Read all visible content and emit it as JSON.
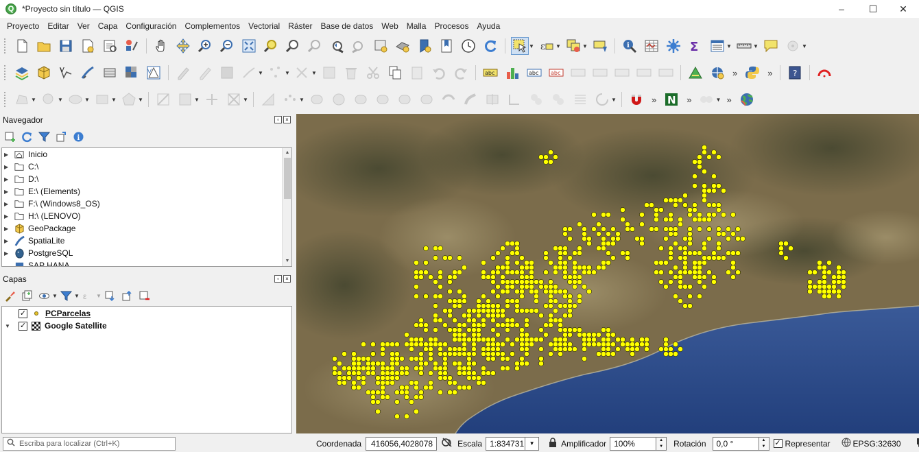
{
  "window": {
    "title": "*Proyecto sin título — QGIS",
    "controls": [
      "–",
      "☐",
      "✕"
    ]
  },
  "menu": [
    "Proyecto",
    "Editar",
    "Ver",
    "Capa",
    "Configuración",
    "Complementos",
    "Vectorial",
    "Ráster",
    "Base de datos",
    "Web",
    "Malla",
    "Procesos",
    "Ayuda"
  ],
  "navigator": {
    "title": "Navegador",
    "items": [
      {
        "label": "Inicio",
        "icon": "home-folder-icon"
      },
      {
        "label": "C:\\",
        "icon": "folder-icon"
      },
      {
        "label": "D:\\",
        "icon": "folder-icon"
      },
      {
        "label": "E:\\ (Elements)",
        "icon": "folder-icon"
      },
      {
        "label": "F:\\ (Windows8_OS)",
        "icon": "folder-icon"
      },
      {
        "label": "H:\\ (LENOVO)",
        "icon": "folder-icon"
      },
      {
        "label": "GeoPackage",
        "icon": "geopackage-icon"
      },
      {
        "label": "SpatiaLite",
        "icon": "spatialite-icon"
      },
      {
        "label": "PostgreSQL",
        "icon": "postgresql-icon"
      },
      {
        "label": "SAP HANA",
        "icon": "sap-hana-icon"
      }
    ]
  },
  "layers_panel": {
    "title": "Capas",
    "layers": [
      {
        "name": "PCParcelas",
        "checked": true,
        "icon": "point-layer-icon"
      },
      {
        "name": "Google Satellite",
        "checked": true,
        "icon": "raster-layer-icon"
      }
    ]
  },
  "map": {
    "layer_points_color": "#ffff00",
    "description_colors": {
      "land": "#7a6b4a",
      "sea": "#2d4a86"
    }
  },
  "statusbar": {
    "locate_placeholder": "Escriba para localizar (Ctrl+K)",
    "coordinate_label": "Coordenada",
    "coordinate_value": "416056,4028078",
    "scale_label": "Escala",
    "scale_value": "1:834731",
    "magnifier_label": "Amplificador",
    "magnifier_value": "100%",
    "rotation_label": "Rotación",
    "rotation_value": "0,0 °",
    "render_label": "Representar",
    "render_checked": true,
    "crs_label": "EPSG:32630"
  }
}
